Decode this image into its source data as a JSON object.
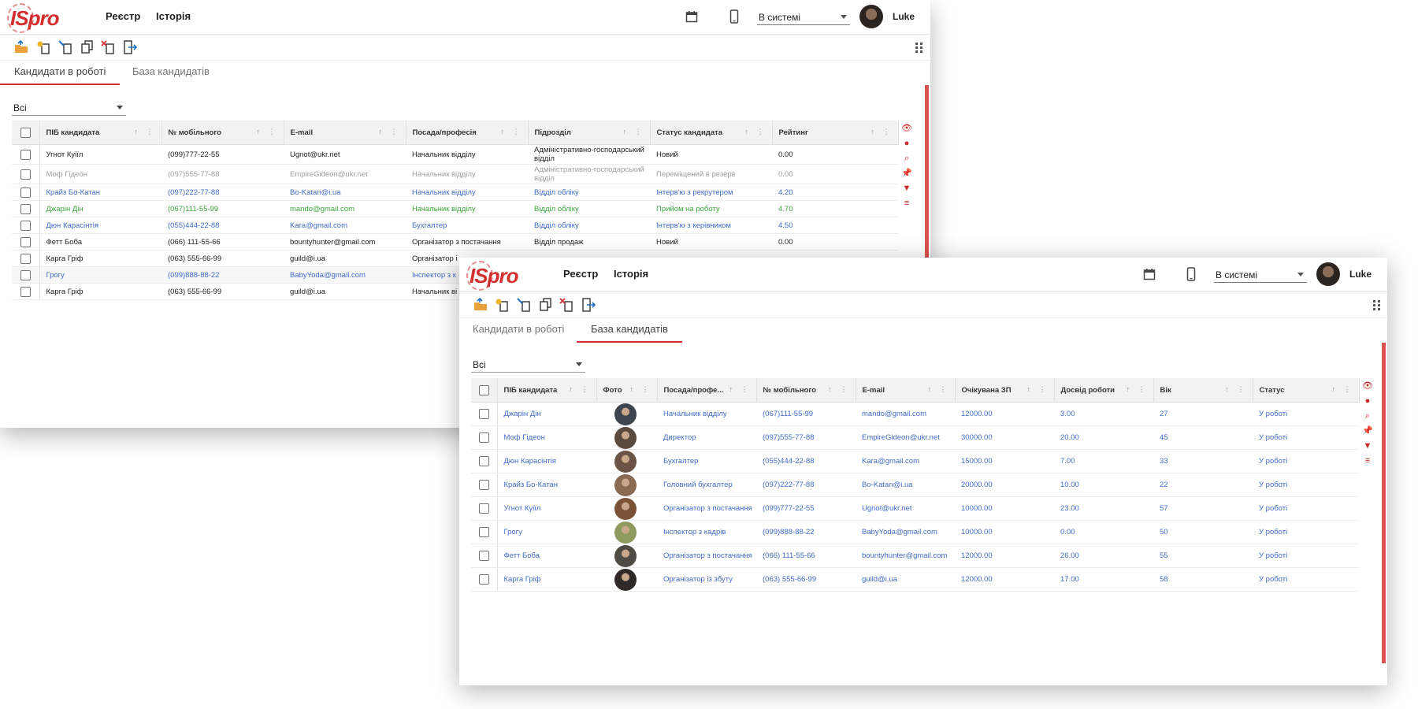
{
  "app": {
    "logo": "ISpro",
    "menu": [
      "Реєстр",
      "Історія"
    ],
    "status": "В системі",
    "user": "Luke"
  },
  "toolbar_icons": [
    "open-folder-icon",
    "add-document-icon",
    "edit-document-icon",
    "copy-icon",
    "delete-icon",
    "export-icon"
  ],
  "tabs": [
    "Кандидати в роботі",
    "База кандидатів"
  ],
  "filter_value": "Всі",
  "colors": {
    "accent": "#d32f2f",
    "blue": "#3f6cc4",
    "green": "#3aa33a",
    "grey": "#9e9e9e"
  },
  "side_icons": [
    "eye-icon",
    "palette-icon",
    "search-icon",
    "pin-icon",
    "filter-icon",
    "sort-icon"
  ],
  "window1": {
    "active_tab": 0,
    "columns": [
      "ПІБ кандидата",
      "№ мобільного",
      "E-mail",
      "Посада/професія",
      "Підрозділ",
      "Статус кандидата",
      "Рейтинг"
    ],
    "rows": [
      {
        "style": "normal",
        "cells": [
          "Угнот Куіїл",
          "(099)777-22-55",
          "Ugnot@ukr.net",
          "Начальник відділу",
          "Адміністративно-господарський відділ",
          "Новий",
          "0.00"
        ]
      },
      {
        "style": "grey",
        "cells": [
          "Моф Гідеон",
          "(097)555-77-88",
          "EmpireGideon@ukr.net",
          "Начальник відділу",
          "Адміністративно-господарський відділ",
          "Переміщений в резерв",
          "0.00"
        ]
      },
      {
        "style": "blue",
        "cells": [
          "Крайз Бо-Катан",
          "(097)222-77-88",
          "Bo-Katan@i.ua",
          "Начальник відділу",
          "Відділ обліку",
          "Інтерв'ю з рекрутером",
          "4.20"
        ]
      },
      {
        "style": "green",
        "cells": [
          "Джарін Дін",
          "(067)111-55-99",
          "mando@gmail.com",
          "Начальник відділу",
          "Відділ обліку",
          "Прийом на роботу",
          "4.70"
        ]
      },
      {
        "style": "blue",
        "cells": [
          "Дюн Карасінтія",
          "(055)444-22-88",
          "Kara@gmail.com",
          "Бухгалтер",
          "Відділ обліку",
          "Інтерв'ю з керівником",
          "4.50"
        ]
      },
      {
        "style": "normal",
        "cells": [
          "Фетт Боба",
          "(066) 111-55-66",
          "bountyhunter@gmail.com",
          "Організатор з постачання",
          "Відділ продаж",
          "Новий",
          "0.00"
        ]
      },
      {
        "style": "normal",
        "cells": [
          "Карга Гріф",
          "(063) 555-66-99",
          "guild@i.ua",
          "Організатор і",
          "",
          "",
          ""
        ]
      },
      {
        "style": "blue",
        "cells": [
          "Грогу",
          "(099)888-88-22",
          "BabyYoda@gmail.com",
          "Інспектор з к",
          "",
          "",
          ""
        ]
      },
      {
        "style": "normal",
        "cells": [
          "Карга Гріф",
          "(063) 555-66-99",
          "guild@i.ua",
          "Начальник ві",
          "",
          "",
          ""
        ]
      }
    ]
  },
  "window2": {
    "active_tab": 1,
    "columns": [
      "ПІБ кандидата",
      "Фото",
      "Посада/профе...",
      "№ мобільного",
      "E-mail",
      "Очікувана ЗП",
      "Досвід роботи",
      "Вік",
      "Статус"
    ],
    "rows": [
      {
        "name": "Джарін Дін",
        "photo": "#3d4650",
        "position": "Начальник відділу",
        "phone": "(067)111-55-99",
        "email": "mando@gmail.com",
        "salary": "12000.00",
        "experience": "3.00",
        "age": "27",
        "status": "У роботі"
      },
      {
        "name": "Моф Гідеон",
        "photo": "#5a4a3e",
        "position": "Директор",
        "phone": "(097)555-77-88",
        "email": "EmpireGideon@ukr.net",
        "salary": "30000.00",
        "experience": "20.00",
        "age": "45",
        "status": "У роботі"
      },
      {
        "name": "Дюн Карасінтія",
        "photo": "#6b5446",
        "position": "Бухгалтер",
        "phone": "(055)444-22-88",
        "email": "Kara@gmail.com",
        "salary": "15000.00",
        "experience": "7.00",
        "age": "33",
        "status": "У роботі"
      },
      {
        "name": "Крайз Бо-Катан",
        "photo": "#8a6a52",
        "position": "Головний бухгалтер",
        "phone": "(097)222-77-88",
        "email": "Bo-Katan@i.ua",
        "salary": "20000.00",
        "experience": "10.00",
        "age": "22",
        "status": "У роботі"
      },
      {
        "name": "Угнот Куіїл",
        "photo": "#7a5236",
        "position": "Організатор з постачання",
        "phone": "(099)777-22-55",
        "email": "Ugnot@ukr.net",
        "salary": "10000.00",
        "experience": "23.00",
        "age": "57",
        "status": "У роботі"
      },
      {
        "name": "Грогу",
        "photo": "#8f9a5e",
        "position": "Інспектор з кадрів",
        "phone": "(099)888-88-22",
        "email": "BabyYoda@gmail.com",
        "salary": "10000.00",
        "experience": "0.00",
        "age": "50",
        "status": "У роботі"
      },
      {
        "name": "Фетт Боба",
        "photo": "#4e4a44",
        "position": "Організатор з постачання",
        "phone": "(066) 111-55-66",
        "email": "bountyhunter@gmail.com",
        "salary": "12000.00",
        "experience": "26.00",
        "age": "55",
        "status": "У роботі"
      },
      {
        "name": "Карга Гріф",
        "photo": "#2f2a28",
        "position": "Організатор із збуту",
        "phone": "(063) 555-66-99",
        "email": "guild@i.ua",
        "salary": "12000.00",
        "experience": "17.00",
        "age": "58",
        "status": "У роботі"
      }
    ]
  }
}
